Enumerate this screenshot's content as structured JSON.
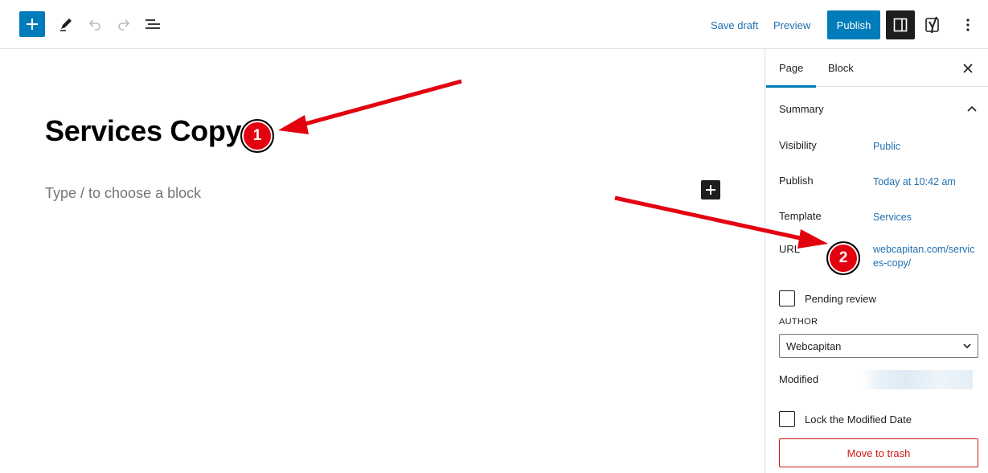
{
  "toolbar": {
    "add_icon": "plus-icon",
    "tools_icon": "pencil-icon",
    "undo_icon": "undo-icon",
    "redo_icon": "redo-icon",
    "outline_icon": "list-view-icon",
    "save_draft_label": "Save draft",
    "preview_label": "Preview",
    "publish_label": "Publish",
    "settings_icon": "sidebar-icon",
    "yoast_icon": "yoast-icon",
    "more_icon": "vertical-ellipsis-icon"
  },
  "editor": {
    "title": "Services Copy",
    "placeholder": "Type / to choose a block"
  },
  "sidebar": {
    "tabs": [
      "Page",
      "Block"
    ],
    "section_title": "Summary",
    "rows": {
      "visibility_label": "Visibility",
      "visibility_value": "Public",
      "publish_label": "Publish",
      "publish_value": "Today at 10:42 am",
      "template_label": "Template",
      "template_value": "Services",
      "url_label": "URL",
      "url_value": "webcapitan.com/services-copy/"
    },
    "pending_review_label": "Pending review",
    "author_label": "AUTHOR",
    "author_value": "Webcapitan",
    "modified_label": "Modified",
    "lock_modified_label": "Lock the Modified Date",
    "trash_label": "Move to trash"
  },
  "annotations": [
    {
      "number": "1"
    },
    {
      "number": "2"
    }
  ],
  "colors": {
    "accent": "#007cba",
    "link": "#2271b1",
    "danger": "#cc1818",
    "annotation": "#e3000f"
  }
}
